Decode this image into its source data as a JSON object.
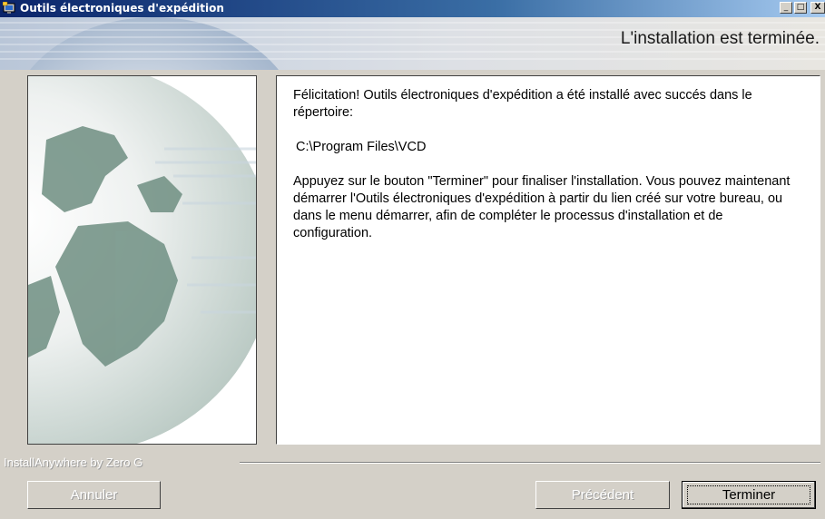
{
  "window": {
    "title": "Outils électroniques d'expédition",
    "app_icon": "installer-icon",
    "controls": {
      "minimize": "_",
      "maximize": "□",
      "close": "X"
    }
  },
  "header": {
    "title": "L'installation est terminée."
  },
  "content": {
    "paragraph1": "Félicitation! Outils électroniques d'expédition a été installé avec succés dans le répertoire:",
    "install_path": "C:\\Program Files\\VCD",
    "paragraph2": "Appuyez sur le bouton \"Terminer\" pour finaliser l'installation. Vous pouvez maintenant démarrer l'Outils électroniques d'expédition à partir du lien créé sur votre bureau, ou dans le menu démarrer, afin de compléter le processus d'installation et de configuration."
  },
  "footer": {
    "vendor_label": "InstallAnywhere by Zero G",
    "buttons": {
      "cancel": "Annuler",
      "previous": "Précédent",
      "finish": "Terminer"
    }
  },
  "colors": {
    "title_bar_start": "#0a246a",
    "title_bar_end": "#a6caf0",
    "dialog_face": "#d4d0c8",
    "panel_background": "#ffffff"
  }
}
